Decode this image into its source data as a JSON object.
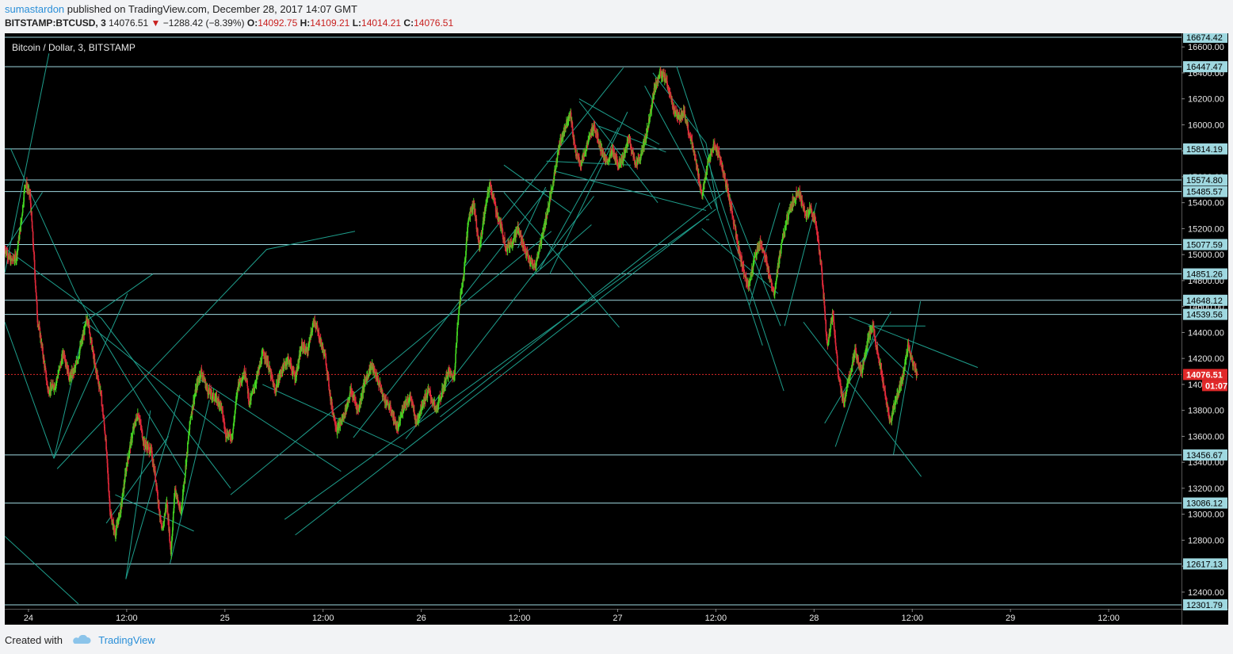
{
  "header": {
    "author": "sumastardon",
    "published_text": " published on TradingView.com, December 28, 2017 14:07 GMT",
    "symbol": "BITSTAMP:BTCUSD, 3",
    "last": "14076.51",
    "change_arrow": "▼",
    "change": "−1288.42 (−8.39%)",
    "o_label": "O:",
    "o_value": "14092.75",
    "h_label": "H:",
    "h_value": "14109.21",
    "l_label": "L:",
    "l_value": "14014.21",
    "c_label": "C:",
    "c_value": "14076.51"
  },
  "footer": {
    "created_with": "Created with",
    "brand": "TradingView"
  },
  "colors": {
    "up": "#44d622",
    "down": "#e0293a",
    "level": "#9fd8e0",
    "trend": "#1e9e8c",
    "last_price": "#e0292a"
  },
  "chart_data": {
    "type": "candlestick",
    "title": "Bitcoin / Dollar, 3, BITSTAMP",
    "ylim": [
      12301.79,
      16674.42
    ],
    "y_ticks": [
      12400,
      12600,
      12800,
      13000,
      13200,
      13400,
      13600,
      13800,
      14000,
      14200,
      14400,
      14600,
      14800,
      15000,
      15200,
      15400,
      15600,
      15800,
      16000,
      16200,
      16400,
      16600
    ],
    "x_ticks": [
      "24",
      "12:00",
      "25",
      "12:00",
      "26",
      "12:00",
      "27",
      "12:00",
      "28",
      "12:00",
      "29",
      "12:00"
    ],
    "x_tick_hours": [
      24,
      36,
      48,
      60,
      72,
      84,
      96,
      108,
      120,
      132,
      144,
      156
    ],
    "x_range_hours": [
      21.1,
      164.9
    ],
    "horizontal_levels": [
      16674.42,
      16447.47,
      15814.19,
      15574.8,
      15485.57,
      15077.59,
      14851.26,
      14648.12,
      14539.56,
      13456.67,
      13086.12,
      12617.13,
      12301.79
    ],
    "last_price": {
      "value": 14076.51,
      "label": "14076.51",
      "countdown": "01:07"
    },
    "price_path": [
      [
        21.1,
        15050
      ],
      [
        21.8,
        14950
      ],
      [
        22.5,
        14980
      ],
      [
        23.1,
        15250
      ],
      [
        23.6,
        15560
      ],
      [
        24.2,
        15450
      ],
      [
        24.6,
        15050
      ],
      [
        25.1,
        14500
      ],
      [
        25.5,
        14350
      ],
      [
        26.4,
        13950
      ],
      [
        27.3,
        14000
      ],
      [
        28.3,
        14250
      ],
      [
        29.0,
        14050
      ],
      [
        29.7,
        14120
      ],
      [
        30.6,
        14350
      ],
      [
        31.2,
        14520
      ],
      [
        32.1,
        14150
      ],
      [
        32.8,
        13950
      ],
      [
        33.4,
        13600
      ],
      [
        34.0,
        13000
      ],
      [
        34.6,
        12850
      ],
      [
        35.3,
        13050
      ],
      [
        36.0,
        13380
      ],
      [
        36.8,
        13650
      ],
      [
        37.4,
        13780
      ],
      [
        38.1,
        13550
      ],
      [
        39.0,
        13480
      ],
      [
        39.6,
        13250
      ],
      [
        40.3,
        12850
      ],
      [
        40.9,
        13100
      ],
      [
        41.4,
        12700
      ],
      [
        41.9,
        13200
      ],
      [
        42.6,
        13000
      ],
      [
        43.1,
        13300
      ],
      [
        43.8,
        13750
      ],
      [
        44.6,
        14000
      ],
      [
        45.1,
        14100
      ],
      [
        45.9,
        13950
      ],
      [
        46.7,
        13900
      ],
      [
        47.5,
        13850
      ],
      [
        48.1,
        13620
      ],
      [
        48.9,
        13600
      ],
      [
        49.6,
        14000
      ],
      [
        50.5,
        14100
      ],
      [
        51.0,
        13850
      ],
      [
        51.9,
        14050
      ],
      [
        52.7,
        14250
      ],
      [
        53.3,
        14150
      ],
      [
        54.1,
        13950
      ],
      [
        54.9,
        14100
      ],
      [
        55.7,
        14200
      ],
      [
        56.6,
        14050
      ],
      [
        57.4,
        14300
      ],
      [
        58.1,
        14250
      ],
      [
        58.9,
        14500
      ],
      [
        59.6,
        14350
      ],
      [
        60.3,
        14200
      ],
      [
        61.0,
        13850
      ],
      [
        61.7,
        13650
      ],
      [
        62.5,
        13750
      ],
      [
        63.4,
        13950
      ],
      [
        64.3,
        13800
      ],
      [
        65.0,
        14000
      ],
      [
        65.9,
        14150
      ],
      [
        66.6,
        14050
      ],
      [
        67.4,
        13900
      ],
      [
        68.3,
        13800
      ],
      [
        69.1,
        13650
      ],
      [
        69.9,
        13850
      ],
      [
        70.7,
        13900
      ],
      [
        71.4,
        13700
      ],
      [
        72.1,
        13850
      ],
      [
        72.9,
        13950
      ],
      [
        73.8,
        13800
      ],
      [
        74.6,
        13950
      ],
      [
        75.3,
        14100
      ],
      [
        76.0,
        14050
      ],
      [
        76.6,
        14600
      ],
      [
        77.2,
        14850
      ],
      [
        77.8,
        15300
      ],
      [
        78.4,
        15400
      ],
      [
        79.1,
        15050
      ],
      [
        79.8,
        15350
      ],
      [
        80.4,
        15550
      ],
      [
        81.1,
        15350
      ],
      [
        81.8,
        15200
      ],
      [
        82.4,
        15050
      ],
      [
        83.1,
        15100
      ],
      [
        83.8,
        15200
      ],
      [
        84.6,
        15050
      ],
      [
        85.2,
        14950
      ],
      [
        85.9,
        14900
      ],
      [
        86.6,
        15100
      ],
      [
        87.3,
        15300
      ],
      [
        88.1,
        15550
      ],
      [
        88.7,
        15800
      ],
      [
        89.4,
        15950
      ],
      [
        90.2,
        16100
      ],
      [
        90.8,
        15800
      ],
      [
        91.5,
        15700
      ],
      [
        92.3,
        15850
      ],
      [
        93.1,
        16000
      ],
      [
        93.8,
        15850
      ],
      [
        94.6,
        15700
      ],
      [
        95.3,
        15800
      ],
      [
        96.0,
        15700
      ],
      [
        96.7,
        15750
      ],
      [
        97.4,
        15900
      ],
      [
        98.1,
        15700
      ],
      [
        98.8,
        15750
      ],
      [
        99.6,
        15950
      ],
      [
        100.4,
        16250
      ],
      [
        101.1,
        16400
      ],
      [
        101.9,
        16350
      ],
      [
        102.7,
        16150
      ],
      [
        103.4,
        16050
      ],
      [
        104.1,
        16100
      ],
      [
        104.9,
        15900
      ],
      [
        105.6,
        15700
      ],
      [
        106.3,
        15450
      ],
      [
        107.0,
        15700
      ],
      [
        107.8,
        15850
      ],
      [
        108.5,
        15750
      ],
      [
        109.2,
        15550
      ],
      [
        109.9,
        15350
      ],
      [
        110.6,
        15100
      ],
      [
        111.3,
        14900
      ],
      [
        112.0,
        14750
      ],
      [
        112.8,
        15000
      ],
      [
        113.5,
        15100
      ],
      [
        114.3,
        14900
      ],
      [
        115.1,
        14700
      ],
      [
        115.8,
        15000
      ],
      [
        116.6,
        15250
      ],
      [
        117.4,
        15400
      ],
      [
        118.1,
        15500
      ],
      [
        118.9,
        15300
      ],
      [
        119.6,
        15350
      ],
      [
        120.2,
        15250
      ],
      [
        120.9,
        14900
      ],
      [
        121.6,
        14300
      ],
      [
        122.3,
        14550
      ],
      [
        123.0,
        14050
      ],
      [
        123.6,
        13850
      ],
      [
        124.3,
        14050
      ],
      [
        125.0,
        14250
      ],
      [
        125.8,
        14100
      ],
      [
        126.6,
        14350
      ],
      [
        127.2,
        14450
      ],
      [
        127.9,
        14200
      ],
      [
        128.6,
        13950
      ],
      [
        129.3,
        13700
      ],
      [
        130.1,
        13900
      ],
      [
        130.8,
        14050
      ],
      [
        131.5,
        14300
      ],
      [
        132.1,
        14150
      ],
      [
        132.6,
        14076.51
      ]
    ],
    "trendlines": [
      [
        [
          21.1,
          14860
        ],
        [
          26.5,
          16550
        ]
      ],
      [
        [
          21.1,
          15030
        ],
        [
          25.7,
          15480
        ]
      ],
      [
        [
          21.8,
          15820
        ],
        [
          29.8,
          14700
        ],
        [
          43.1,
          13300
        ]
      ],
      [
        [
          21.1,
          15050
        ],
        [
          32.9,
          14510
        ],
        [
          48.7,
          13200
        ]
      ],
      [
        [
          21.1,
          14480
        ],
        [
          27.1,
          13430
        ]
      ],
      [
        [
          27.1,
          13430
        ],
        [
          36.1,
          14700
        ]
      ],
      [
        [
          21.1,
          12830
        ],
        [
          30.1,
          12310
        ]
      ],
      [
        [
          27.1,
          13430
        ],
        [
          31.0,
          14490
        ]
      ],
      [
        [
          27.5,
          13350
        ],
        [
          53.1,
          15040
        ],
        [
          63.9,
          15180
        ]
      ],
      [
        [
          33.5,
          12930
        ],
        [
          41.1,
          13600
        ]
      ],
      [
        [
          30.6,
          14470
        ],
        [
          39.2,
          14850
        ]
      ],
      [
        [
          35.9,
          12500
        ],
        [
          38.9,
          13800
        ]
      ],
      [
        [
          35.9,
          12500
        ],
        [
          42.5,
          13920
        ]
      ],
      [
        [
          41.3,
          12620
        ],
        [
          46.1,
          13880
        ]
      ],
      [
        [
          34.6,
          13150
        ],
        [
          44.2,
          12870
        ]
      ],
      [
        [
          31.0,
          14480
        ],
        [
          48.4,
          13600
        ]
      ],
      [
        [
          44.6,
          14050
        ],
        [
          62.2,
          13330
        ]
      ],
      [
        [
          52.6,
          14000
        ],
        [
          69.9,
          13500
        ]
      ],
      [
        [
          63.7,
          13590
        ],
        [
          87.3,
          15500
        ]
      ],
      [
        [
          48.7,
          13150
        ],
        [
          87.9,
          15180
        ]
      ],
      [
        [
          55.3,
          12960
        ],
        [
          107.0,
          15300
        ]
      ],
      [
        [
          56.6,
          12840
        ],
        [
          108.0,
          15350
        ]
      ],
      [
        [
          70.1,
          13580
        ],
        [
          93.1,
          15450
        ]
      ],
      [
        [
          74.3,
          13750
        ],
        [
          109.4,
          15500
        ]
      ],
      [
        [
          77.2,
          14900
        ],
        [
          96.7,
          16440
        ]
      ],
      [
        [
          82.1,
          15690
        ],
        [
          90.3,
          15320
        ]
      ],
      [
        [
          82.1,
          15480
        ],
        [
          96.2,
          14440
        ]
      ],
      [
        [
          83.8,
          15050
        ],
        [
          87.2,
          15520
        ]
      ],
      [
        [
          85.5,
          14830
        ],
        [
          92.8,
          15230
        ]
      ],
      [
        [
          86.5,
          14890
        ],
        [
          96.1,
          15980
        ]
      ],
      [
        [
          87.7,
          14850
        ],
        [
          97.2,
          16100
        ]
      ],
      [
        [
          93.7,
          15990
        ],
        [
          101.9,
          15790
        ]
      ],
      [
        [
          88.5,
          15640
        ],
        [
          106.8,
          15340
        ]
      ],
      [
        [
          87.3,
          15720
        ],
        [
          97.6,
          15690
        ]
      ],
      [
        [
          91.3,
          16180
        ],
        [
          100.9,
          15400
        ]
      ],
      [
        [
          91.3,
          16200
        ],
        [
          101.1,
          15850
        ]
      ],
      [
        [
          100.3,
          16400
        ],
        [
          106.8,
          15860
        ]
      ],
      [
        [
          106.8,
          15860
        ],
        [
          108.2,
          15350
        ]
      ],
      [
        [
          103.2,
          16450
        ],
        [
          116.3,
          13950
        ]
      ],
      [
        [
          99.3,
          16300
        ],
        [
          107.5,
          15350
        ]
      ],
      [
        [
          106.8,
          15270
        ],
        [
          107.2,
          15270
        ]
      ],
      [
        [
          105.8,
          15800
        ],
        [
          113.7,
          14300
        ]
      ],
      [
        [
          106.3,
          15200
        ],
        [
          115.6,
          14700
        ]
      ],
      [
        [
          112.1,
          14610
        ],
        [
          115.8,
          15400
        ]
      ],
      [
        [
          116.4,
          14450
        ],
        [
          120.3,
          15400
        ]
      ],
      [
        [
          109.3,
          15510
        ],
        [
          115.9,
          14450
        ]
      ],
      [
        [
          118.7,
          14480
        ],
        [
          133.1,
          13290
        ]
      ],
      [
        [
          121.3,
          13700
        ],
        [
          129.4,
          14560
        ]
      ],
      [
        [
          122.6,
          13520
        ],
        [
          127.4,
          14400
        ]
      ],
      [
        [
          124.3,
          14520
        ],
        [
          140.0,
          14130
        ]
      ],
      [
        [
          129.7,
          13460
        ],
        [
          133.0,
          14640
        ]
      ],
      [
        [
          126.6,
          14450
        ],
        [
          133.6,
          14450
        ]
      ],
      [
        [
          127.2,
          14350
        ],
        [
          132.1,
          14050
        ]
      ]
    ]
  }
}
